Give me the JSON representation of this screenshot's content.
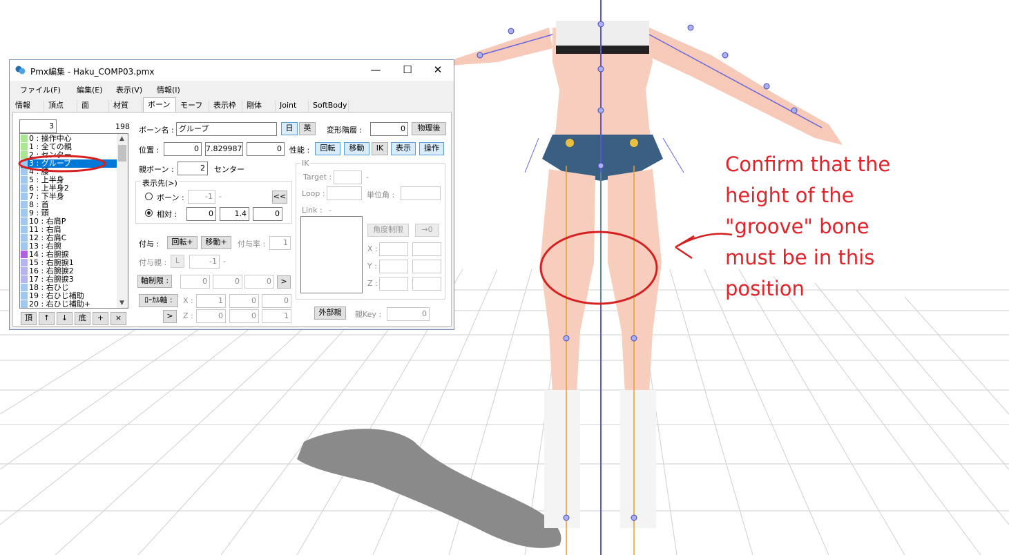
{
  "annotation": {
    "lines": [
      "Confirm that the",
      "height of the",
      "\"groove\" bone",
      "must be in this",
      "position"
    ]
  },
  "window": {
    "title": "Pmx編集 - Haku_COMP03.pmx",
    "controls": {
      "minimize": "—",
      "maximize": "☐",
      "close": "✕"
    },
    "menu": [
      "ファイル(F)",
      "編集(E)",
      "表示(V)",
      "情報(I)"
    ],
    "tabs": [
      "情報",
      "頂点",
      "面",
      "材質",
      "ボーン",
      "モーフ",
      "表示枠",
      "剛体",
      "Joint",
      "SoftBody"
    ],
    "active_tab": "ボーン"
  },
  "bone_list": {
    "index_value": "3",
    "count": "198",
    "items": [
      {
        "label": "0 : 操作中心",
        "color": "#a8e890"
      },
      {
        "label": "1 : 全ての親",
        "color": "#a8e890"
      },
      {
        "label": "2 : センター",
        "color": "#a8e890"
      },
      {
        "label": "3 : グルーブ",
        "color": "#9fc8f0",
        "selected": true
      },
      {
        "label": "4 : 腰",
        "color": "#9fc8f0"
      },
      {
        "label": "5 : 上半身",
        "color": "#9fc8f0"
      },
      {
        "label": "6 : 上半身2",
        "color": "#9fc8f0"
      },
      {
        "label": "7 : 下半身",
        "color": "#9fc8f0"
      },
      {
        "label": "8 : 首",
        "color": "#9fc8f0"
      },
      {
        "label": "9 : 頭",
        "color": "#9fc8f0"
      },
      {
        "label": "10 : 右肩P",
        "color": "#9fc8f0"
      },
      {
        "label": "11 : 右肩",
        "color": "#9fc8f0"
      },
      {
        "label": "12 : 右肩C",
        "color": "#9fc8f0"
      },
      {
        "label": "13 : 右腕",
        "color": "#9fc8f0"
      },
      {
        "label": "14 : 右腕捩",
        "color": "#b060e0"
      },
      {
        "label": "15 : 右腕捩1",
        "color": "#b4b4f0"
      },
      {
        "label": "16 : 右腕捩2",
        "color": "#b4b4f0"
      },
      {
        "label": "17 : 右腕捩3",
        "color": "#b4b4f0"
      },
      {
        "label": "18 : 右ひじ",
        "color": "#9fc8f0"
      },
      {
        "label": "19 : 右ひじ補助",
        "color": "#9fc8f0"
      },
      {
        "label": "20 : 右ひじ補助+",
        "color": "#9fc8f0"
      }
    ],
    "buttons": [
      "頂",
      "↑",
      "↓",
      "底",
      "+",
      "×"
    ]
  },
  "bone": {
    "name_label": "ボーン名 :",
    "name": "グルーブ",
    "lang_jp": "日",
    "lang_en": "英",
    "deform_label": "変形階層 :",
    "deform_value": "0",
    "after_physics": "物理後",
    "position_label": "位置 :",
    "position": [
      "0",
      "7.829987",
      "0"
    ],
    "perf_label": "性能 :",
    "flags": [
      "回転",
      "移動",
      "IK",
      "表示",
      "操作"
    ],
    "parent_label": "親ボーン :",
    "parent_index": "2",
    "parent_name": "センター",
    "dest_label": "表示先(>)",
    "dest_bone_label": "ボーン :",
    "dest_bone_value": "-1",
    "dest_bone_dash": "-",
    "dest_back": "<<",
    "dest_rel_label": "相対 :",
    "dest_rel": [
      "0",
      "1.4",
      "0"
    ],
    "grant_label": "付与 :",
    "grant_rot": "回転+",
    "grant_move": "移動+",
    "grant_rate_label": "付与率 :",
    "grant_rate": "1",
    "grant_parent_label": "付与親 :",
    "grant_parent_btn": "L",
    "grant_parent_value": "-1",
    "grant_parent_dash": "-",
    "axis_limit": "軸制限 :",
    "axis_values": [
      "0",
      "0",
      "0"
    ],
    "axis_btn": ">",
    "local_axis": "ﾛｰｶﾙ軸 :",
    "local_btn": ">",
    "local_x_label": "X :",
    "local_x": [
      "1",
      "0",
      "0"
    ],
    "local_z_label": "Z :",
    "local_z": [
      "0",
      "0",
      "1"
    ]
  },
  "ik": {
    "group_label": "IK",
    "target_label": "Target :",
    "target_dash": "-",
    "loop_label": "Loop :",
    "unit_label": "単位角 :",
    "link_label": "Link :",
    "link_dash": "-",
    "angle_limit": "角度制限",
    "zero_btn": "→0",
    "x_label": "X :",
    "y_label": "Y :",
    "z_label": "Z :",
    "ext_parent": "外部親",
    "key_label": "親Key :",
    "key_value": "0"
  }
}
